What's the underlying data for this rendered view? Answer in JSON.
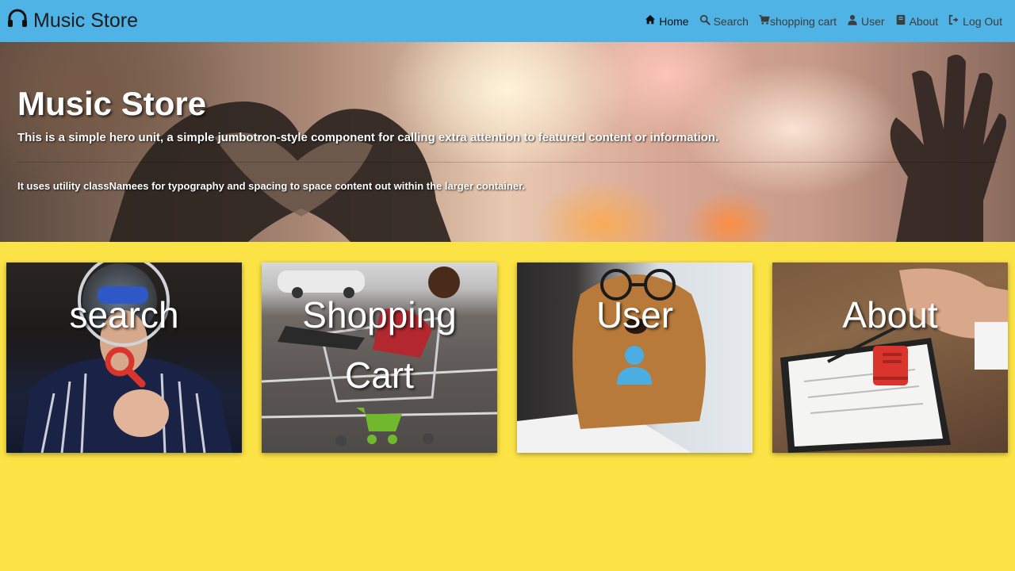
{
  "navbar": {
    "brand": "Music Store",
    "links": [
      {
        "label": "Home",
        "icon": "home-icon",
        "active": true
      },
      {
        "label": "Search",
        "icon": "search-icon"
      },
      {
        "label": "shopping cart",
        "icon": "cart-icon"
      },
      {
        "label": "User",
        "icon": "user-icon"
      },
      {
        "label": "About",
        "icon": "book-icon"
      },
      {
        "label": "Log Out",
        "icon": "logout-icon"
      }
    ]
  },
  "hero": {
    "title": "Music Store",
    "lead": "This is a simple hero unit, a simple jumbotron-style component for calling extra attention to featured content or information.",
    "text": "It uses utility classNamees for typography and spacing to space content out within the larger container."
  },
  "cards": [
    {
      "title": "search",
      "icon": "magnifier-icon",
      "icon_color": "#d9352d"
    },
    {
      "title": "Shopping Cart",
      "icon": "cart-icon",
      "icon_color": "#72b82e"
    },
    {
      "title": "User",
      "icon": "user-icon",
      "icon_color": "#4aaee3"
    },
    {
      "title": "About",
      "icon": "book-icon",
      "icon_color": "#d9352d"
    }
  ],
  "colors": {
    "navbar_bg": "#4fb3e5",
    "page_bg": "#fce345"
  }
}
